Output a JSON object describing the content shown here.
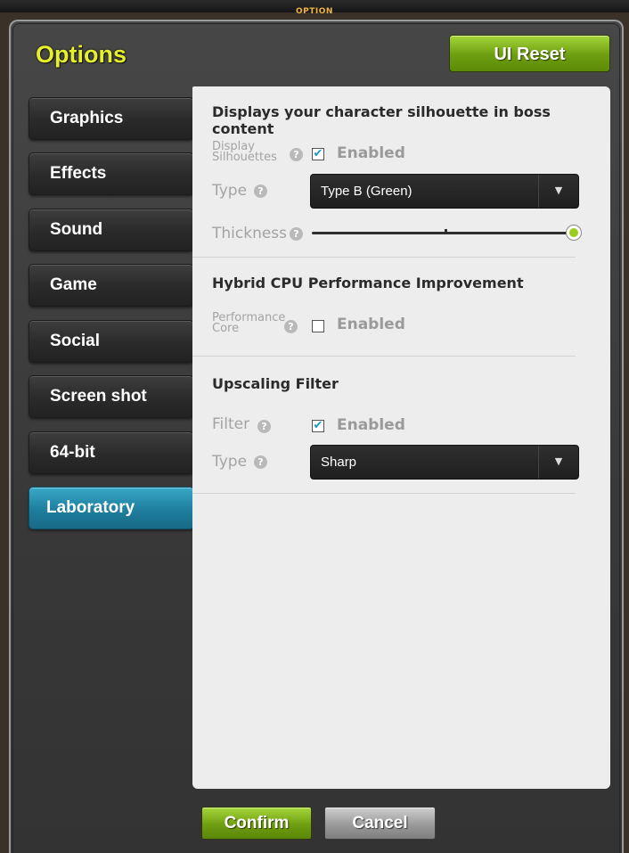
{
  "window": {
    "title": "OPTION"
  },
  "header": {
    "title": "Options",
    "reset_label": "UI Reset"
  },
  "sidebar": {
    "items": [
      {
        "label": "Graphics"
      },
      {
        "label": "Effects"
      },
      {
        "label": "Sound"
      },
      {
        "label": "Game"
      },
      {
        "label": "Social"
      },
      {
        "label": "Screen shot"
      },
      {
        "label": "64-bit"
      },
      {
        "label": "Laboratory",
        "active": true
      }
    ]
  },
  "panel": {
    "silhouette": {
      "heading": "Displays your character silhouette in boss content",
      "display_label_line1": "Display",
      "display_label_line2": "Silhouettes",
      "enabled_label": "Enabled",
      "enabled": true,
      "type_label": "Type",
      "type_value": "Type B (Green)",
      "thickness_label": "Thickness",
      "thickness_level": 1.0
    },
    "hybrid_cpu": {
      "heading": "Hybrid CPU Performance Improvement",
      "label_line1": "Performance",
      "label_line2": "Core",
      "enabled_label": "Enabled",
      "enabled": false
    },
    "upscaling": {
      "heading": "Upscaling Filter",
      "filter_label": "Filter",
      "enabled_label": "Enabled",
      "enabled": true,
      "type_label": "Type",
      "type_value": "Sharp"
    }
  },
  "footer": {
    "confirm_label": "Confirm",
    "cancel_label": "Cancel"
  },
  "colors": {
    "title_yellow": "#e6ef2c",
    "accent_green": "#8cc426",
    "active_teal": "#1e7e9e",
    "checkbox_check": "#1a9ac0"
  }
}
